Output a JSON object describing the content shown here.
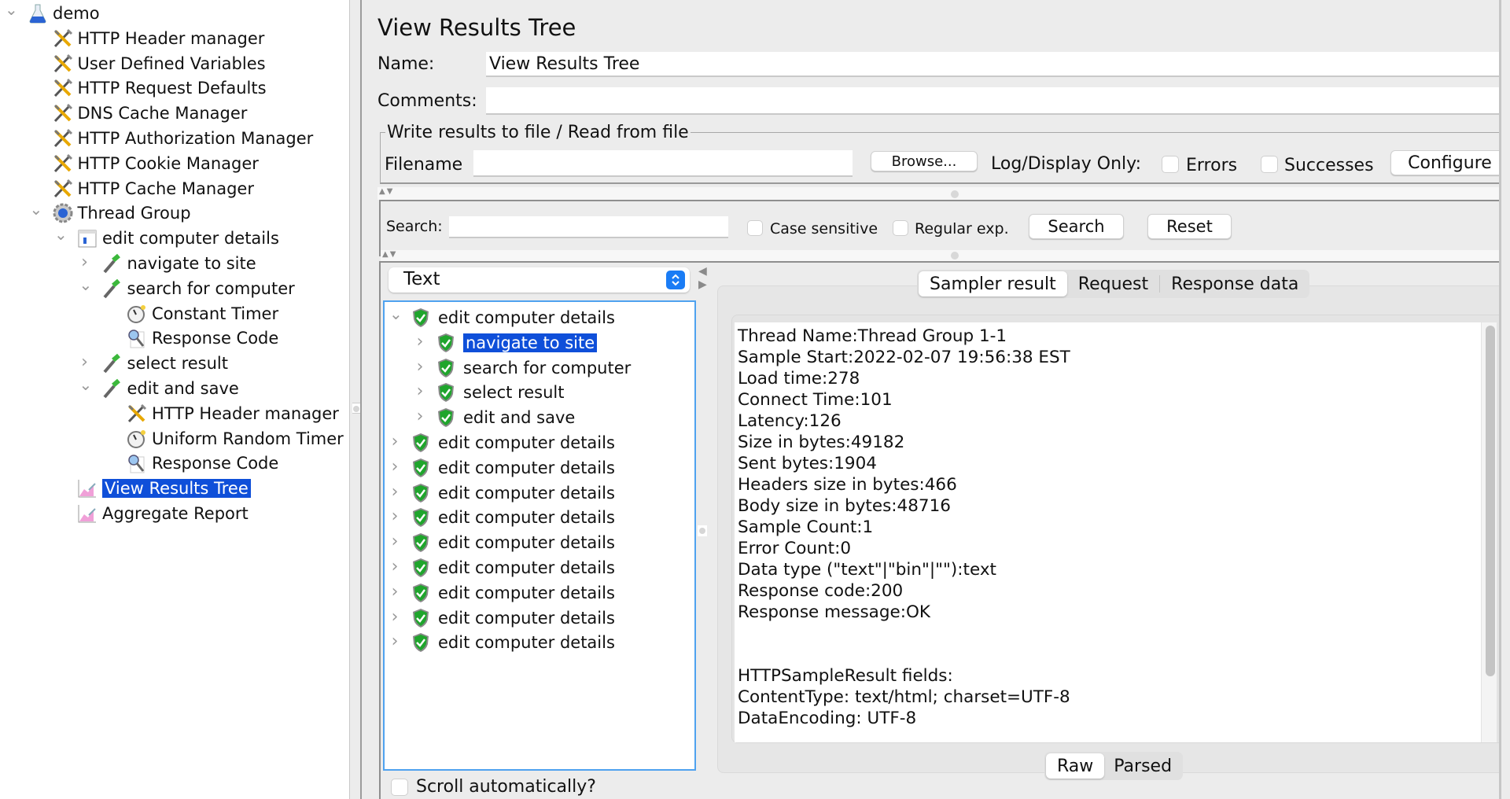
{
  "test_plan_tree": {
    "items": [
      {
        "label": "demo",
        "icon": "test-plan-flask-icon",
        "indent": 0,
        "expander": "expanded"
      },
      {
        "label": "HTTP Header manager",
        "icon": "config-element-tools-icon",
        "indent": 1,
        "expander": "none"
      },
      {
        "label": "User Defined Variables",
        "icon": "config-element-tools-icon",
        "indent": 1,
        "expander": "none"
      },
      {
        "label": "HTTP Request Defaults",
        "icon": "config-element-tools-icon",
        "indent": 1,
        "expander": "none"
      },
      {
        "label": "DNS Cache Manager",
        "icon": "config-element-tools-icon",
        "indent": 1,
        "expander": "none"
      },
      {
        "label": "HTTP Authorization Manager",
        "icon": "config-element-tools-icon",
        "indent": 1,
        "expander": "none"
      },
      {
        "label": "HTTP Cookie Manager",
        "icon": "config-element-tools-icon",
        "indent": 1,
        "expander": "none"
      },
      {
        "label": "HTTP Cache Manager",
        "icon": "config-element-tools-icon",
        "indent": 1,
        "expander": "none"
      },
      {
        "label": "Thread Group",
        "icon": "thread-group-gear-icon",
        "indent": 1,
        "expander": "expanded"
      },
      {
        "label": "edit computer details",
        "icon": "transaction-controller-icon",
        "indent": 2,
        "expander": "expanded"
      },
      {
        "label": "navigate to site",
        "icon": "http-sampler-pipette-icon",
        "indent": 3,
        "expander": "collapsed"
      },
      {
        "label": "search for computer",
        "icon": "http-sampler-pipette-icon",
        "indent": 3,
        "expander": "expanded"
      },
      {
        "label": "Constant Timer",
        "icon": "timer-clock-icon",
        "indent": 4,
        "expander": "none"
      },
      {
        "label": "Response Code",
        "icon": "assertion-magnifier-icon",
        "indent": 4,
        "expander": "none"
      },
      {
        "label": "select result",
        "icon": "http-sampler-pipette-icon",
        "indent": 3,
        "expander": "collapsed"
      },
      {
        "label": "edit and save",
        "icon": "http-sampler-pipette-icon",
        "indent": 3,
        "expander": "expanded"
      },
      {
        "label": "HTTP Header manager",
        "icon": "config-element-tools-icon",
        "indent": 4,
        "expander": "none"
      },
      {
        "label": "Uniform Random Timer",
        "icon": "timer-clock-icon",
        "indent": 4,
        "expander": "none"
      },
      {
        "label": "Response Code",
        "icon": "assertion-magnifier-icon",
        "indent": 4,
        "expander": "none"
      },
      {
        "label": "View Results Tree",
        "icon": "listener-graph-icon",
        "indent": 2,
        "expander": "none",
        "selected": true
      },
      {
        "label": "Aggregate Report",
        "icon": "listener-graph-icon",
        "indent": 2,
        "expander": "none"
      }
    ]
  },
  "panel": {
    "title": "View Results Tree",
    "name_label": "Name:",
    "name_value": "View Results Tree",
    "comments_label": "Comments:",
    "comments_value": "",
    "file_group_title": "Write results to file / Read from file",
    "filename_label": "Filename",
    "filename_value": "",
    "browse_button": "Browse...",
    "log_display_label": "Log/Display Only:",
    "errors_label": "Errors",
    "errors_checked": false,
    "successes_label": "Successes",
    "successes_checked": false,
    "configure_button": "Configure"
  },
  "search": {
    "label": "Search:",
    "value": "",
    "case_sensitive_label": "Case sensitive",
    "case_sensitive_checked": false,
    "regex_label": "Regular exp.",
    "regex_checked": false,
    "search_button": "Search",
    "reset_button": "Reset"
  },
  "renderer": {
    "selected": "Text"
  },
  "results_tree": {
    "items": [
      {
        "label": "edit computer details",
        "status": "success",
        "indent": 0,
        "expander": "expanded"
      },
      {
        "label": "navigate to site",
        "status": "success",
        "indent": 1,
        "expander": "collapsed",
        "selected": true
      },
      {
        "label": "search for computer",
        "status": "success",
        "indent": 1,
        "expander": "collapsed"
      },
      {
        "label": "select result",
        "status": "success",
        "indent": 1,
        "expander": "collapsed"
      },
      {
        "label": "edit and save",
        "status": "success",
        "indent": 1,
        "expander": "collapsed"
      },
      {
        "label": "edit computer details",
        "status": "success",
        "indent": 0,
        "expander": "collapsed"
      },
      {
        "label": "edit computer details",
        "status": "success",
        "indent": 0,
        "expander": "collapsed"
      },
      {
        "label": "edit computer details",
        "status": "success",
        "indent": 0,
        "expander": "collapsed"
      },
      {
        "label": "edit computer details",
        "status": "success",
        "indent": 0,
        "expander": "collapsed"
      },
      {
        "label": "edit computer details",
        "status": "success",
        "indent": 0,
        "expander": "collapsed"
      },
      {
        "label": "edit computer details",
        "status": "success",
        "indent": 0,
        "expander": "collapsed"
      },
      {
        "label": "edit computer details",
        "status": "success",
        "indent": 0,
        "expander": "collapsed"
      },
      {
        "label": "edit computer details",
        "status": "success",
        "indent": 0,
        "expander": "collapsed"
      },
      {
        "label": "edit computer details",
        "status": "success",
        "indent": 0,
        "expander": "collapsed"
      }
    ],
    "scroll_auto_label": "Scroll automatically?",
    "scroll_auto_checked": false
  },
  "detail": {
    "tabs": [
      "Sampler result",
      "Request",
      "Response data"
    ],
    "active_tab": "Sampler result",
    "sampler_result_lines": [
      "Thread Name:Thread Group 1-1",
      "Sample Start:2022-02-07 19:56:38 EST",
      "Load time:278",
      "Connect Time:101",
      "Latency:126",
      "Size in bytes:49182",
      "Sent bytes:1904",
      "Headers size in bytes:466",
      "Body size in bytes:48716",
      "Sample Count:1",
      "Error Count:0",
      "Data type (\"text\"|\"bin\"|\"\"):text",
      "Response code:200",
      "Response message:OK",
      "",
      "",
      "HTTPSampleResult fields:",
      "ContentType: text/html; charset=UTF-8",
      "DataEncoding: UTF-8"
    ],
    "view_modes": [
      "Raw",
      "Parsed"
    ],
    "active_view_mode": "Raw"
  },
  "colors": {
    "selection": "#0f4fd9",
    "focus_border": "#4fa2ef",
    "success_green": "#1fa52c",
    "select_accent": "#1a7cf5"
  }
}
